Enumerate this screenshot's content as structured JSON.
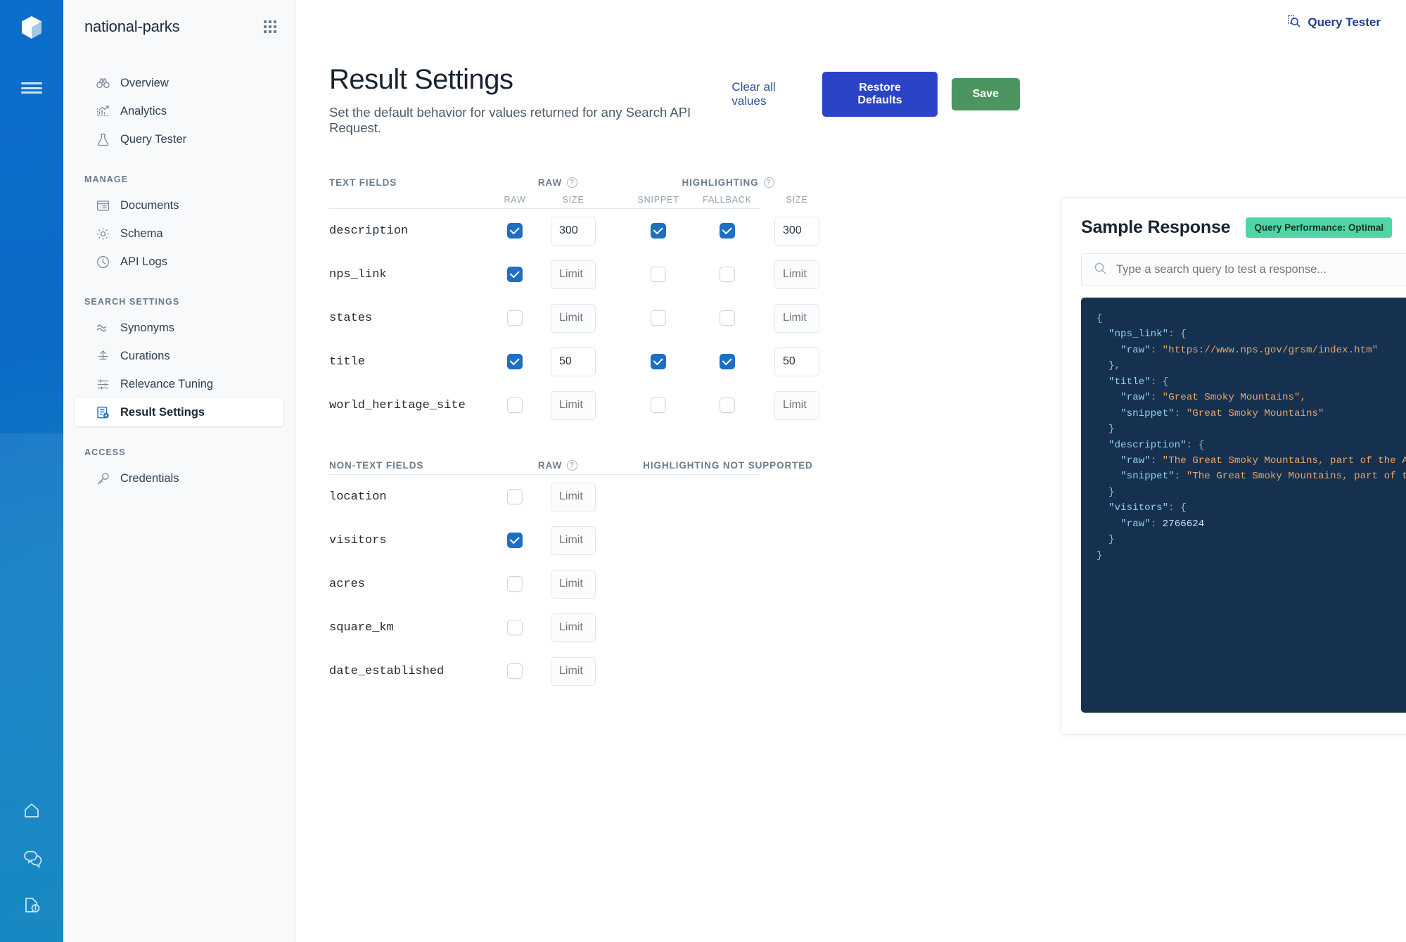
{
  "rail": {
    "logo_icon": "cube-logo-icon",
    "menu_icon": "hamburger-menu-icon",
    "bottom_icons": [
      "home-icon",
      "chat-feedback-icon",
      "document-info-icon"
    ]
  },
  "sidebar": {
    "engine_name": "national-parks",
    "apps_icon": "grid-apps-icon",
    "items": [
      {
        "label": "Overview",
        "icon": "binoculars-icon",
        "active": false,
        "group": null
      },
      {
        "label": "Analytics",
        "icon": "chart-up-icon",
        "active": false,
        "group": null
      },
      {
        "label": "Query Tester",
        "icon": "flask-icon",
        "active": false,
        "group": null
      },
      {
        "label": "Documents",
        "icon": "document-list-icon",
        "active": false,
        "group": "MANAGE"
      },
      {
        "label": "Schema",
        "icon": "gear-icon",
        "active": false,
        "group": "MANAGE"
      },
      {
        "label": "API Logs",
        "icon": "clock-icon",
        "active": false,
        "group": "MANAGE"
      },
      {
        "label": "Synonyms",
        "icon": "wave-icon",
        "active": false,
        "group": "SEARCH SETTINGS"
      },
      {
        "label": "Curations",
        "icon": "boost-arrow-icon",
        "active": false,
        "group": "SEARCH SETTINGS"
      },
      {
        "label": "Relevance Tuning",
        "icon": "sliders-icon",
        "active": false,
        "group": "SEARCH SETTINGS"
      },
      {
        "label": "Result Settings",
        "icon": "result-settings-icon",
        "active": true,
        "group": "SEARCH SETTINGS"
      },
      {
        "label": "Credentials",
        "icon": "key-icon",
        "active": false,
        "group": "ACCESS"
      }
    ],
    "groups": [
      "MANAGE",
      "SEARCH SETTINGS",
      "ACCESS"
    ]
  },
  "topbar": {
    "query_tester_label": "Query Tester",
    "query_tester_icon": "query-tester-magnifier-icon"
  },
  "header": {
    "title": "Result Settings",
    "subtitle": "Set the default behavior for values returned for any Search API Request.",
    "clear_all_label": "Clear all values",
    "restore_defaults_label": "Restore Defaults",
    "save_label": "Save"
  },
  "text_fields_table": {
    "section_label": "TEXT FIELDS",
    "group_raw_label": "RAW",
    "group_highlighting_label": "HIGHLIGHTING",
    "col_raw": "RAW",
    "col_size": "SIZE",
    "col_snippet": "SNIPPET",
    "col_fallback": "FALLBACK",
    "col_size2": "SIZE",
    "help_icon": "help-circle-icon",
    "limit_placeholder": "Limit",
    "rows": [
      {
        "name": "description",
        "raw": true,
        "raw_size": "300",
        "snippet": true,
        "fallback": true,
        "hl_size": "300"
      },
      {
        "name": "nps_link",
        "raw": true,
        "raw_size": "",
        "snippet": false,
        "fallback": false,
        "hl_size": ""
      },
      {
        "name": "states",
        "raw": false,
        "raw_size": "",
        "snippet": false,
        "fallback": false,
        "hl_size": ""
      },
      {
        "name": "title",
        "raw": true,
        "raw_size": "50",
        "snippet": true,
        "fallback": true,
        "hl_size": "50"
      },
      {
        "name": "world_heritage_site",
        "raw": false,
        "raw_size": "",
        "snippet": false,
        "fallback": false,
        "hl_size": ""
      }
    ]
  },
  "non_text_fields_table": {
    "section_label": "NON-TEXT FIELDS",
    "group_raw_label": "RAW",
    "highlighting_note": "HIGHLIGHTING NOT SUPPORTED",
    "help_icon": "help-circle-icon",
    "limit_placeholder": "Limit",
    "rows": [
      {
        "name": "location",
        "raw": false,
        "raw_size": ""
      },
      {
        "name": "visitors",
        "raw": true,
        "raw_size": ""
      },
      {
        "name": "acres",
        "raw": false,
        "raw_size": ""
      },
      {
        "name": "square_km",
        "raw": false,
        "raw_size": ""
      },
      {
        "name": "date_established",
        "raw": false,
        "raw_size": ""
      }
    ]
  },
  "sample_response": {
    "title": "Sample Response",
    "badge": "Query Performance: Optimal",
    "search_placeholder": "Type a search query to test a response...",
    "search_value": "",
    "search_icon": "search-icon",
    "json_lines": [
      {
        "indent": 0,
        "parts": [
          {
            "t": "{",
            "c": "b"
          }
        ]
      },
      {
        "indent": 1,
        "parts": [
          {
            "t": "\"nps_link\"",
            "c": "k"
          },
          {
            "t": ":",
            "c": "p"
          },
          {
            "t": " {",
            "c": "b"
          }
        ]
      },
      {
        "indent": 2,
        "parts": [
          {
            "t": "\"raw\"",
            "c": "k"
          },
          {
            "t": ":",
            "c": "p"
          },
          {
            "t": " \"https://www.nps.gov/grsm/index.htm\"",
            "c": "s"
          }
        ]
      },
      {
        "indent": 1,
        "parts": [
          {
            "t": "},",
            "c": "b"
          }
        ]
      },
      {
        "indent": 1,
        "parts": [
          {
            "t": "\"title\"",
            "c": "k"
          },
          {
            "t": ":",
            "c": "p"
          },
          {
            "t": " {",
            "c": "b"
          }
        ]
      },
      {
        "indent": 2,
        "parts": [
          {
            "t": "\"raw\"",
            "c": "k"
          },
          {
            "t": ":",
            "c": "p"
          },
          {
            "t": " \"Great Smoky Mountains\",",
            "c": "s"
          }
        ]
      },
      {
        "indent": 2,
        "parts": [
          {
            "t": "\"snippet\"",
            "c": "k"
          },
          {
            "t": ":",
            "c": "p"
          },
          {
            "t": " \"Great Smoky Mountains\"",
            "c": "s"
          }
        ]
      },
      {
        "indent": 1,
        "parts": [
          {
            "t": "}",
            "c": "b"
          }
        ]
      },
      {
        "indent": 1,
        "parts": [
          {
            "t": "\"description\"",
            "c": "k"
          },
          {
            "t": ":",
            "c": "p"
          },
          {
            "t": " {",
            "c": "b"
          }
        ]
      },
      {
        "indent": 2,
        "parts": [
          {
            "t": "\"raw\"",
            "c": "k"
          },
          {
            "t": ":",
            "c": "p"
          },
          {
            "t": " \"The Great Smoky Mountains, part of the Appa",
            "c": "s"
          }
        ]
      },
      {
        "indent": 2,
        "parts": [
          {
            "t": "\"snippet\"",
            "c": "k"
          },
          {
            "t": ":",
            "c": "p"
          },
          {
            "t": " \"The Great Smoky Mountains, part of the ",
            "c": "s"
          }
        ]
      },
      {
        "indent": 1,
        "parts": [
          {
            "t": "}",
            "c": "b"
          }
        ]
      },
      {
        "indent": 1,
        "parts": [
          {
            "t": "\"visitors\"",
            "c": "k"
          },
          {
            "t": ":",
            "c": "p"
          },
          {
            "t": " {",
            "c": "b"
          }
        ]
      },
      {
        "indent": 2,
        "parts": [
          {
            "t": "\"raw\"",
            "c": "k"
          },
          {
            "t": ":",
            "c": "p"
          },
          {
            "t": " 2766624",
            "c": "n"
          }
        ]
      },
      {
        "indent": 1,
        "parts": [
          {
            "t": "}",
            "c": "b"
          }
        ]
      },
      {
        "indent": 0,
        "parts": [
          {
            "t": "}",
            "c": "b"
          }
        ]
      }
    ]
  },
  "colors": {
    "rail_blue": "#0b6ecb",
    "accent_blue": "#1d6fc4",
    "primary_button": "#2b44c7",
    "save_button": "#4b9560",
    "badge_green": "#50d6a5",
    "code_bg": "#15314f",
    "link_blue": "#2a4ea8"
  }
}
